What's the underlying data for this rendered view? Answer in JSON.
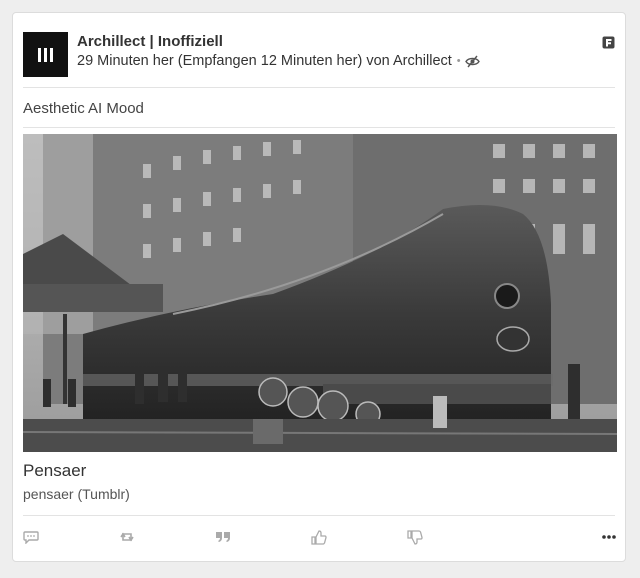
{
  "post": {
    "source_name": "Archillect | Inoffiziell",
    "meta_text": "29 Minuten her (Empfangen 12 Minuten her) von Archillect",
    "meta_separator": "•",
    "title": "Aesthetic AI Mood",
    "image_description_icon": "photo",
    "caption_title": "Pensaer",
    "caption_source": "pensaer (Tumblr)"
  },
  "icons": {
    "avatar": "archillect-logo-icon",
    "hide": "eye-slash-icon",
    "brand": "feedly-icon",
    "actions": [
      "comment-icon",
      "retweet-icon",
      "quote-icon",
      "thumbs-up-icon",
      "thumbs-down-icon",
      "more-icon"
    ]
  },
  "colors": {
    "icon": "#aaaaaa",
    "text": "#333333",
    "avatar_bg": "#111111"
  }
}
